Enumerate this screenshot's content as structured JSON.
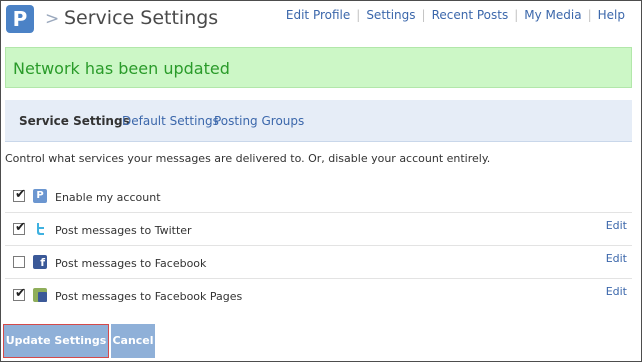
{
  "header": {
    "logo_letter": "P",
    "separator": ">",
    "title": "Service Settings",
    "nav": [
      {
        "label": "Edit Profile"
      },
      {
        "label": "Settings"
      },
      {
        "label": "Recent Posts"
      },
      {
        "label": "My Media"
      },
      {
        "label": "Help"
      }
    ],
    "nav_separator": "|"
  },
  "banner": {
    "message": "Network has been updated"
  },
  "subtabs": {
    "active": "Service Settings",
    "default_settings": "Default Settings",
    "posting_groups": "Posting Groups"
  },
  "description": "Control what services your messages are delivered to. Or, disable your account entirely.",
  "services": [
    {
      "label": "Enable my account",
      "checked": true,
      "icon": "posterous-icon",
      "edit": ""
    },
    {
      "label": "Post messages to Twitter",
      "checked": true,
      "icon": "twitter-icon",
      "edit": "Edit"
    },
    {
      "label": "Post messages to Facebook",
      "checked": false,
      "icon": "facebook-icon",
      "edit": "Edit"
    },
    {
      "label": "Post messages to Facebook Pages",
      "checked": true,
      "icon": "facebook-pages-icon",
      "edit": "Edit"
    }
  ],
  "buttons": {
    "update": "Update Settings",
    "cancel": "Cancel"
  },
  "colors": {
    "accent": "#3b67ab",
    "success_bg": "#ccf7c6",
    "success_text": "#2a9b2a",
    "button": "#8fb0d8"
  }
}
